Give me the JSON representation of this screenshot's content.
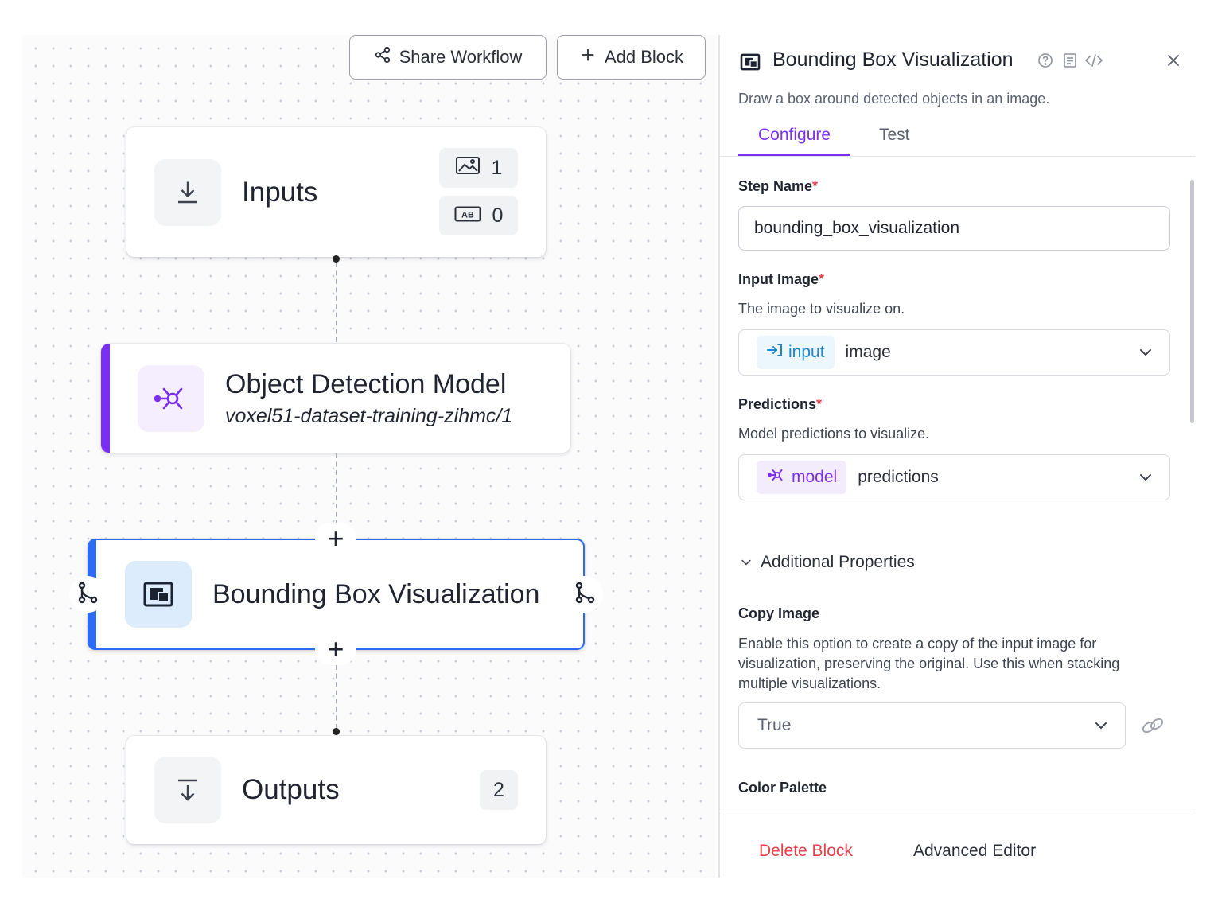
{
  "toolbar": {
    "share_label": "Share Workflow",
    "add_block_label": "Add Block"
  },
  "nodes": {
    "inputs": {
      "title": "Inputs",
      "image_count": "1",
      "text_count": "0"
    },
    "object_detection": {
      "title": "Object Detection Model",
      "subtitle": "voxel51-dataset-training-zihmc/1"
    },
    "bounding_box": {
      "title": "Bounding Box Visualization"
    },
    "outputs": {
      "title": "Outputs",
      "count": "2"
    }
  },
  "panel": {
    "title": "Bounding Box Visualization",
    "description": "Draw a box around detected objects in an image.",
    "tabs": [
      {
        "label": "Configure",
        "active": true
      },
      {
        "label": "Test",
        "active": false
      }
    ],
    "step_name": {
      "label": "Step Name",
      "required_mark": "*",
      "value": "bounding_box_visualization"
    },
    "input_image": {
      "label": "Input Image",
      "required_mark": "*",
      "description": "The image to visualize on.",
      "chip": "input",
      "value": "image"
    },
    "predictions": {
      "label": "Predictions",
      "required_mark": "*",
      "description": "Model predictions to visualize.",
      "chip": "model",
      "value": "predictions"
    },
    "additional_properties": {
      "label": "Additional Properties"
    },
    "copy_image": {
      "label": "Copy Image",
      "description": "Enable this option to create a copy of the input image for visualization, preserving the original. Use this when stacking multiple visualizations.",
      "value": "True"
    },
    "color_palette": {
      "label": "Color Palette"
    },
    "footer": {
      "delete_label": "Delete Block",
      "advanced_label": "Advanced Editor"
    }
  },
  "colors": {
    "accent_purple": "#7b2ff0",
    "accent_blue": "#2d6bf0",
    "danger_red": "#e0414a",
    "input_blue": "#1e86c9"
  },
  "icons": {
    "share": "share-icon",
    "add": "plus-icon",
    "download": "download-icon",
    "image": "image-icon",
    "text": "text-ab-icon",
    "model": "model-network-icon",
    "bbox": "bounding-box-icon",
    "outputs": "outputs-icon",
    "branch": "branch-icon",
    "help": "help-icon",
    "docs": "docs-icon",
    "code": "code-icon",
    "close": "close-icon",
    "chevron": "chevron-down-icon",
    "link": "link-icon"
  }
}
